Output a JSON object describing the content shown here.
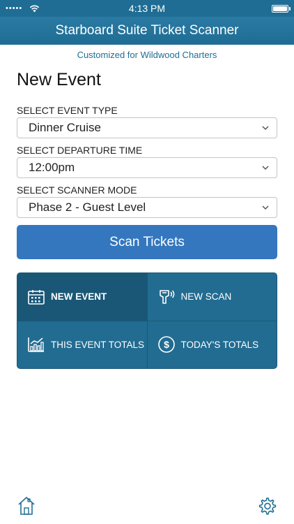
{
  "status_bar": {
    "signal": "•••••",
    "time": "4:13 PM"
  },
  "header": {
    "title": "Starboard Suite Ticket Scanner"
  },
  "subtitle": "Customized for Wildwood Charters",
  "page_title": "New Event",
  "form": {
    "event_type": {
      "label": "SELECT EVENT TYPE",
      "value": "Dinner Cruise"
    },
    "departure_time": {
      "label": "SELECT DEPARTURE TIME",
      "value": "12:00pm"
    },
    "scanner_mode": {
      "label": "SELECT SCANNER MODE",
      "value": "Phase 2 - Guest Level"
    }
  },
  "scan_button": {
    "label": "Scan Tickets"
  },
  "tiles": {
    "new_event": {
      "label": "NEW EVENT",
      "icon": "calendar-icon",
      "active": true
    },
    "new_scan": {
      "label": "NEW SCAN",
      "icon": "scanner-icon"
    },
    "event_totals": {
      "label": "THIS EVENT TOTALS",
      "icon": "chart-icon"
    },
    "todays_totals": {
      "label": "TODAY'S TOTALS",
      "icon": "dollar-icon"
    }
  },
  "tab_bar": {
    "home_icon": "home-icon",
    "settings_icon": "gear-icon"
  },
  "colors": {
    "brand": "#1f6d94",
    "button": "#3477bf",
    "tile": "#226c91",
    "tile_active": "#1a5777"
  }
}
